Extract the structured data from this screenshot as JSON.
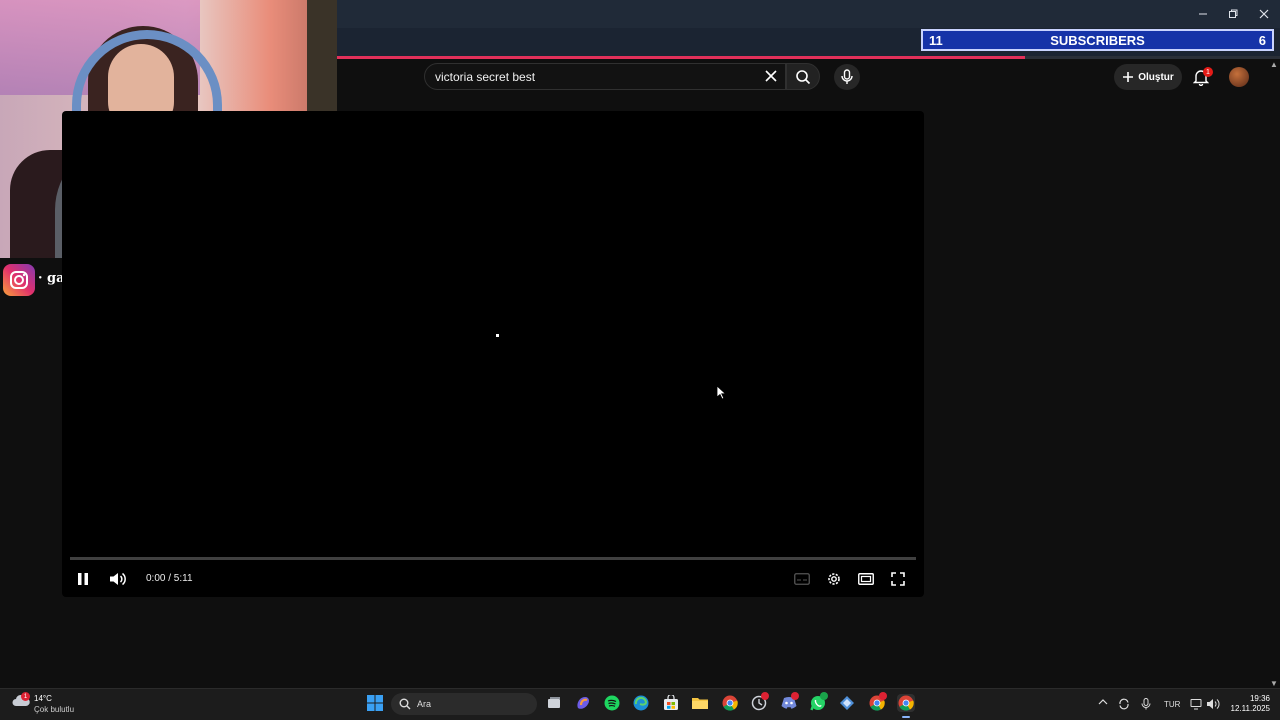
{
  "window": {
    "minimize_icon": "minimize-icon",
    "restore_icon": "restore-icon",
    "close_icon": "close-icon"
  },
  "overlay": {
    "subscribers_left": "11",
    "subscribers_label": "SUBSCRIBERS",
    "subscribers_right": "6",
    "instagram_handle": "· gamzekayal"
  },
  "header": {
    "search_query": "victoria secret best",
    "create_label": "Oluştur",
    "notification_count": "1",
    "load_progress": 0.73
  },
  "player": {
    "time": "0:00 / 5:11",
    "progress": 0.0,
    "controls": [
      "pause-icon",
      "volume-icon",
      "subtitles-icon",
      "settings-icon",
      "theater-mode-icon",
      "fullscreen-icon"
    ]
  },
  "taskbar": {
    "weather_temp": "14°C",
    "weather_condition": "Çok bulutlu",
    "weather_badge": "1",
    "search_label": "Ara",
    "language": "TUR",
    "time": "19:36",
    "date": "12.11.2025",
    "apps": [
      "windows-start-icon",
      "task-view-icon",
      "copilot-icon",
      "spotify-icon",
      "edge-icon",
      "store-icon",
      "file-explorer-icon",
      "chrome-icon",
      "app-icon",
      "discord-icon",
      "whatsapp-icon",
      "app-icon",
      "chrome-icon",
      "chrome-icon"
    ],
    "colors": {
      "accent": "#8ab4f8",
      "youtube_red": "#ff0000",
      "subs_blue": "#1633a8"
    }
  }
}
